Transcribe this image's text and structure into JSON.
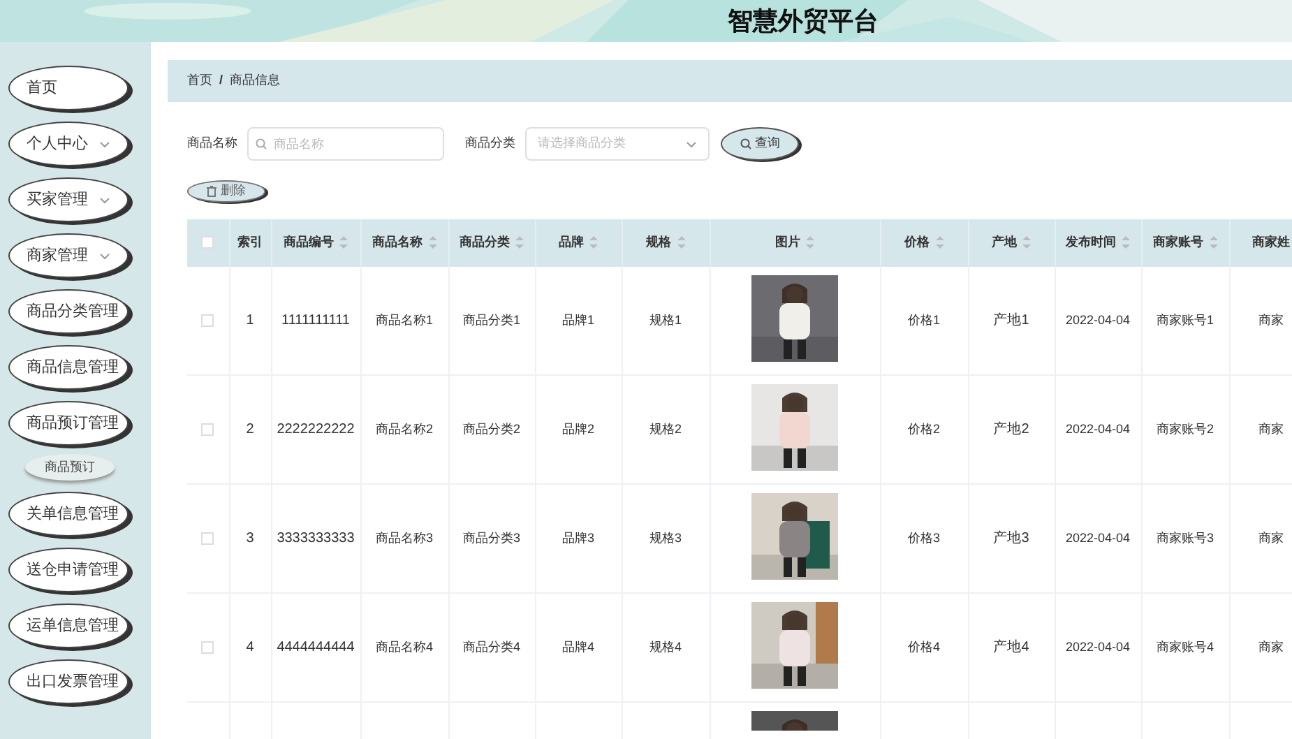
{
  "header": {
    "title": "智慧外贸平台"
  },
  "sidebar": {
    "items": [
      {
        "label": "首页",
        "kind": "link"
      },
      {
        "label": "个人中心",
        "kind": "group"
      },
      {
        "label": "买家管理",
        "kind": "group"
      },
      {
        "label": "商家管理",
        "kind": "group"
      },
      {
        "label": "商品分类管理",
        "kind": "link"
      },
      {
        "label": "商品信息管理",
        "kind": "link"
      },
      {
        "label": "商品预订管理",
        "kind": "link",
        "expanded": true,
        "children": [
          {
            "label": "商品预订"
          }
        ]
      },
      {
        "label": "关单信息管理",
        "kind": "link"
      },
      {
        "label": "送仓申请管理",
        "kind": "link"
      },
      {
        "label": "运单信息管理",
        "kind": "link"
      },
      {
        "label": "出口发票管理",
        "kind": "link"
      }
    ]
  },
  "breadcrumb": [
    "首页",
    "/",
    "商品信息"
  ],
  "search": {
    "name_label": "商品名称",
    "name_placeholder": "商品名称",
    "category_label": "商品分类",
    "category_placeholder": "请选择商品分类",
    "query_button": "查询"
  },
  "delete_button": "删除",
  "table": {
    "columns": [
      {
        "kind": "checkbox",
        "checked": false,
        "sortable": false
      },
      {
        "label": "索引",
        "sortable": false
      },
      {
        "label": "商品编号",
        "sortable": true
      },
      {
        "label": "商品名称",
        "sortable": true
      },
      {
        "label": "商品分类",
        "sortable": true
      },
      {
        "label": "品牌",
        "sortable": true
      },
      {
        "label": "规格",
        "sortable": true
      },
      {
        "label": "图片",
        "sortable": true
      },
      {
        "label": "价格",
        "sortable": true
      },
      {
        "label": "产地",
        "sortable": true
      },
      {
        "label": "发布时间",
        "sortable": true
      },
      {
        "label": "商家账号",
        "sortable": true
      },
      {
        "label": "商家姓",
        "sortable": false
      }
    ],
    "rows": [
      {
        "kind": "full",
        "checked": false,
        "cells": [
          "1",
          "1111111111",
          "商品名称1",
          "商品分类1",
          "品牌1",
          "规格1",
          "价格1",
          "产地1",
          "2022-04-04",
          "商家账号1",
          "商家"
        ]
      },
      {
        "kind": "full",
        "checked": false,
        "cells": [
          "2",
          "2222222222",
          "商品名称2",
          "商品分类2",
          "品牌2",
          "规格2",
          "价格2",
          "产地2",
          "2022-04-04",
          "商家账号2",
          "商家"
        ]
      },
      {
        "kind": "full",
        "checked": false,
        "cells": [
          "3",
          "3333333333",
          "商品名称3",
          "商品分类3",
          "品牌3",
          "规格3",
          "价格3",
          "产地3",
          "2022-04-04",
          "商家账号3",
          "商家"
        ]
      },
      {
        "kind": "full",
        "checked": false,
        "cells": [
          "4",
          "4444444444",
          "商品名称4",
          "商品分类4",
          "品牌4",
          "规格4",
          "价格4",
          "产地4",
          "2022-04-04",
          "商家账号4",
          "商家"
        ]
      },
      {
        "kind": "partial"
      }
    ]
  }
}
